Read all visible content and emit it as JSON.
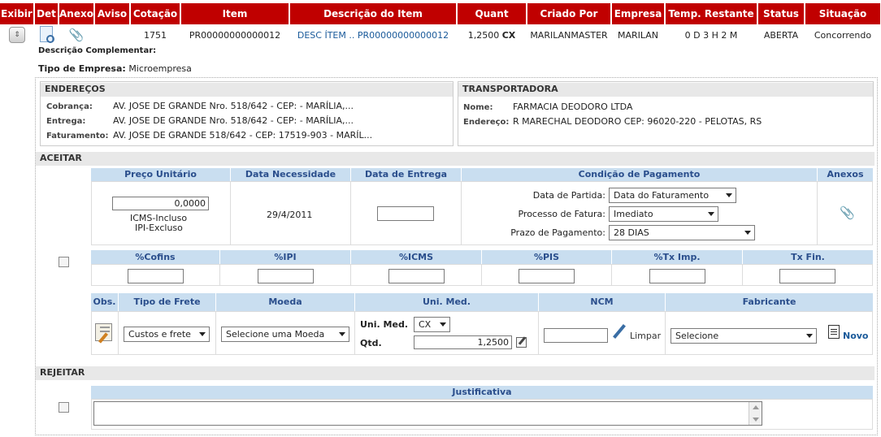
{
  "header": {
    "cols": [
      "Exibir",
      "Det",
      "Anexo",
      "Aviso",
      "Cotação",
      "Item",
      "Descrição do Item",
      "Quant",
      "Criado Por",
      "Empresa",
      "Temp. Restante",
      "Status",
      "Situação"
    ]
  },
  "row": {
    "cotacao": "1751",
    "item": "PR00000000000012",
    "descricao": "DESC ÍTEM .. PR00000000000012",
    "quant": "1,2500",
    "unit": "CX",
    "criado_por": "MARILANMASTER",
    "empresa": "MARILAN",
    "temp_restante": "0 D 3 H 2 M",
    "status": "ABERTA",
    "situacao": "Concorrendo"
  },
  "desc_complementar_label": "Descrição Complementar:",
  "tipo_empresa_label": "Tipo de Empresa:",
  "tipo_empresa_value": "Microempresa",
  "enderecos": {
    "title": "ENDEREÇOS",
    "cobranca_label": "Cobrança:",
    "cobranca": "AV. JOSE DE GRANDE Nro. 518/642 - CEP: - MARÍLIA,...",
    "entrega_label": "Entrega:",
    "entrega": "AV. JOSE DE GRANDE Nro. 518/642 - CEP: - MARÍLIA,...",
    "faturamento_label": "Faturamento:",
    "faturamento": "AV. JOSE DE GRANDE 518/642 - CEP: 17519-903 - MARÍL..."
  },
  "transportadora": {
    "title": "TRANSPORTADORA",
    "nome_label": "Nome:",
    "nome": "FARMACIA DEODORO LTDA",
    "endereco_label": "Endereço:",
    "endereco": "R MARECHAL DEODORO CEP: 96020-220 - PELOTAS, RS"
  },
  "aceitar": {
    "title": "ACEITAR",
    "preco_unitario": "Preço Unitário",
    "data_necessidade": "Data Necessidade",
    "data_entrega": "Data de Entrega",
    "condicao_pagamento": "Condição de Pagamento",
    "anexos": "Anexos",
    "preco_value": "0,0000",
    "icms": "ICMS-Incluso",
    "ipi": "IPI-Excluso",
    "data_necessidade_value": "29/4/2011",
    "data_partida_label": "Data de Partida:",
    "data_partida_value": "Data do Faturamento",
    "processo_fatura_label": "Processo de Fatura:",
    "processo_fatura_value": "Imediato",
    "prazo_pagamento_label": "Prazo de Pagamento:",
    "prazo_pagamento_value": "28 DIAS",
    "cofins": "%Cofins",
    "ipi_pct": "%IPI",
    "icms_pct": "%ICMS",
    "pis": "%PIS",
    "tx_imp": "%Tx Imp.",
    "tx_fin": "Tx Fin.",
    "obs": "Obs.",
    "tipo_frete": "Tipo de Frete",
    "moeda": "Moeda",
    "uni_med": "Uni. Med.",
    "ncm": "NCM",
    "fabricante": "Fabricante",
    "tipo_frete_value": "Custos e frete",
    "moeda_value": "Selecione uma Moeda",
    "uni_med_label": "Uni. Med.",
    "uni_med_value": "CX",
    "qtd_label": "Qtd.",
    "qtd_value": "1,2500",
    "limpar": "Limpar",
    "fabricante_value": "Selecione",
    "novo": "Novo"
  },
  "rejeitar": {
    "title": "REJEITAR",
    "justificativa": "Justificativa"
  }
}
